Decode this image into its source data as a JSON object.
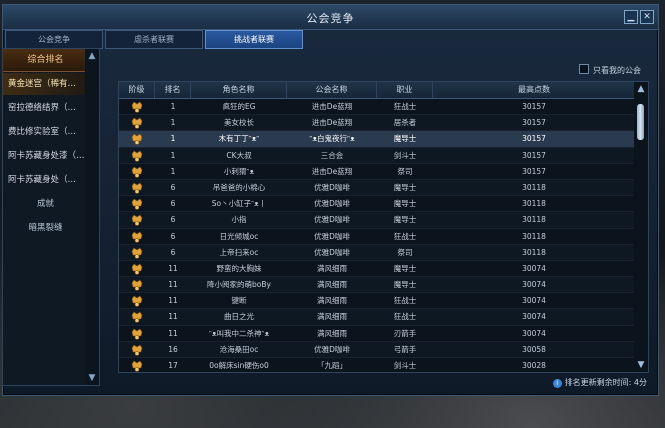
{
  "window": {
    "title": "公会竞争"
  },
  "controls": {
    "minimize_icon": "minimize-icon",
    "close_icon": "close-icon",
    "minimize_glyph": "▁",
    "close_glyph": "✕"
  },
  "tabs": [
    {
      "label": "公会竞争",
      "active": false
    },
    {
      "label": "虐杀者联赛",
      "active": false
    },
    {
      "label": "挑战者联赛",
      "active": true
    }
  ],
  "sidebar": {
    "header": "综合排名",
    "items": [
      {
        "label": "黄金迷宫（稀有…",
        "selected": true
      },
      {
        "label": "窑拉德络结界（…",
        "selected": false
      },
      {
        "label": "费比修实验室（…",
        "selected": false
      },
      {
        "label": "阿卡苏藏身处漆（…",
        "selected": false
      },
      {
        "label": "阿卡苏藏身处（…",
        "selected": false
      },
      {
        "label": "成就",
        "selected": false,
        "center": true
      },
      {
        "label": "暗黑裂缝",
        "selected": false,
        "center": true
      }
    ]
  },
  "filter": {
    "only_mine_label": "只看我的公会",
    "checked": false
  },
  "table": {
    "headers": [
      "阶级",
      "排名",
      "角色名称",
      "公会名称",
      "职业",
      "最高点数"
    ],
    "rows": [
      {
        "rank": "1",
        "name": "疯狂的EG",
        "guild": "进击De蓝翔",
        "job": "狂战士",
        "score": "30157"
      },
      {
        "rank": "1",
        "name": "美女校长",
        "guild": "进击De蓝翔",
        "job": "居杀者",
        "score": "30157"
      },
      {
        "rank": "1",
        "name": "木有丁丁ᵔᴥᵔ",
        "guild": "ᵔᴥ白鬼夜行ᵔᴥ",
        "job": "魔导士",
        "score": "30157",
        "highlight": true
      },
      {
        "rank": "1",
        "name": "CK大叔",
        "guild": "三合会",
        "job": "剑斗士",
        "score": "30157"
      },
      {
        "rank": "1",
        "name": "小刺猬ᵔᴥ",
        "guild": "进击De蓝翔",
        "job": "祭司",
        "score": "30157"
      },
      {
        "rank": "6",
        "name": "吊爸爸的小棉心",
        "guild": "优雅D咖啡",
        "job": "魔导士",
        "score": "30118"
      },
      {
        "rank": "6",
        "name": "So丶小缸子ᵔᴥ丨",
        "guild": "优雅D咖啡",
        "job": "魔导士",
        "score": "30118"
      },
      {
        "rank": "6",
        "name": "小指",
        "guild": "优雅D咖啡",
        "job": "魔导士",
        "score": "30118"
      },
      {
        "rank": "6",
        "name": "日光倾城oc",
        "guild": "优雅D咖啡",
        "job": "狂战士",
        "score": "30118"
      },
      {
        "rank": "6",
        "name": "上帝扫来oc",
        "guild": "优雅D咖啡",
        "job": "祭司",
        "score": "30118"
      },
      {
        "rank": "11",
        "name": "野蛮的大胸妹",
        "guild": "满风细雨",
        "job": "魔导士",
        "score": "30074"
      },
      {
        "rank": "11",
        "name": "降小阅家的萌boBy",
        "guild": "满风细雨",
        "job": "魔导士",
        "score": "30074"
      },
      {
        "rank": "11",
        "name": "键断",
        "guild": "满风细雨",
        "job": "狂战士",
        "score": "30074"
      },
      {
        "rank": "11",
        "name": "曲日之光",
        "guild": "满风细雨",
        "job": "狂战士",
        "score": "30074"
      },
      {
        "rank": "11",
        "name": "ᵔᴥ叫我中二杀神ᵔᴥ",
        "guild": "满风细雨",
        "job": "刃箭手",
        "score": "30074"
      },
      {
        "rank": "16",
        "name": "沧海桑田oc",
        "guild": "优雅D咖啡",
        "job": "弓箭手",
        "score": "30058"
      },
      {
        "rank": "17",
        "name": "0o解床sin硬伤o0",
        "guild": "「九蹈」",
        "job": "剑斗士",
        "score": "30028"
      }
    ]
  },
  "footer": {
    "text": "排名更新剩余时间: 4分"
  },
  "icons": {
    "medal": "crown-medal-icon",
    "info": "info-icon",
    "scroll_up": "scroll-up-icon",
    "scroll_down": "scroll-down-icon"
  },
  "colors": {
    "accent": "#2a5aa0",
    "medal_gold": "#e0a23a"
  }
}
